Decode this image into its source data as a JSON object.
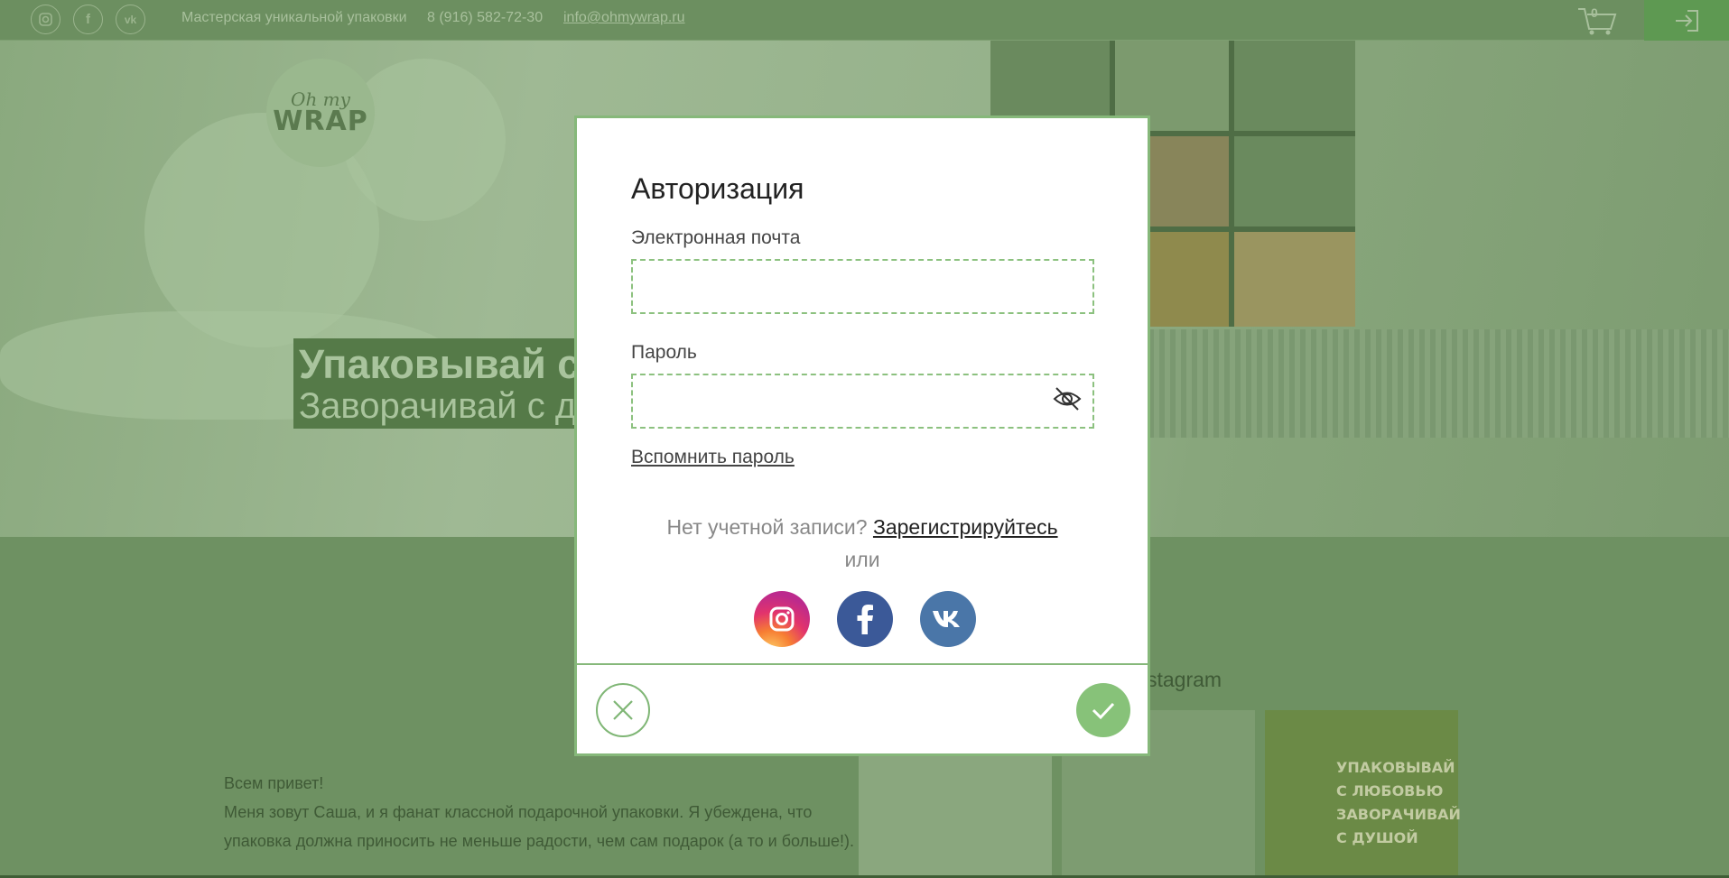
{
  "topbar": {
    "social_icons": [
      "instagram-icon",
      "facebook-icon",
      "vk-icon"
    ],
    "tagline": "Мастерская уникальной упаковки",
    "phone": "8 (916) 582-72-30",
    "email": "info@ohmywrap.ru",
    "cart_count": "0"
  },
  "hero": {
    "logo_top": "Oh my",
    "logo_bottom": "WRAP",
    "slogan_line1": "Упаковывай с",
    "slogan_line2": "Заворачивай с д"
  },
  "instagram": {
    "title_partial": "stagram",
    "tile3_lines": [
      "УПАКОВЫВАЙ",
      "С ЛЮБОВЬЮ",
      "ЗАВОРАЧИВАЙ",
      "С ДУШОЙ"
    ]
  },
  "about": {
    "greeting": "Всем привет!",
    "text": "Меня зовут Саша, и я фанат классной подарочной упаковки. Я убеждена, что упаковка должна приносить не меньше радости, чем сам подарок (а то и больше!)."
  },
  "modal": {
    "title": "Авторизация",
    "email_label": "Электронная почта",
    "email_value": "",
    "password_label": "Пароль",
    "password_value": "",
    "forgot_password": "Вспомнить пароль",
    "no_account": "Нет учетной записи?",
    "register": "Зарегистрируйтесь",
    "or": "или",
    "social_buttons": [
      "instagram",
      "facebook",
      "vk"
    ]
  },
  "colors": {
    "accent_green": "#86b87a",
    "confirm_green": "#87c279",
    "overlay_green": "#6e9162",
    "instagram_gradient": "#e2336c",
    "facebook_blue": "#3b5998",
    "vk_blue": "#4a76a8"
  }
}
